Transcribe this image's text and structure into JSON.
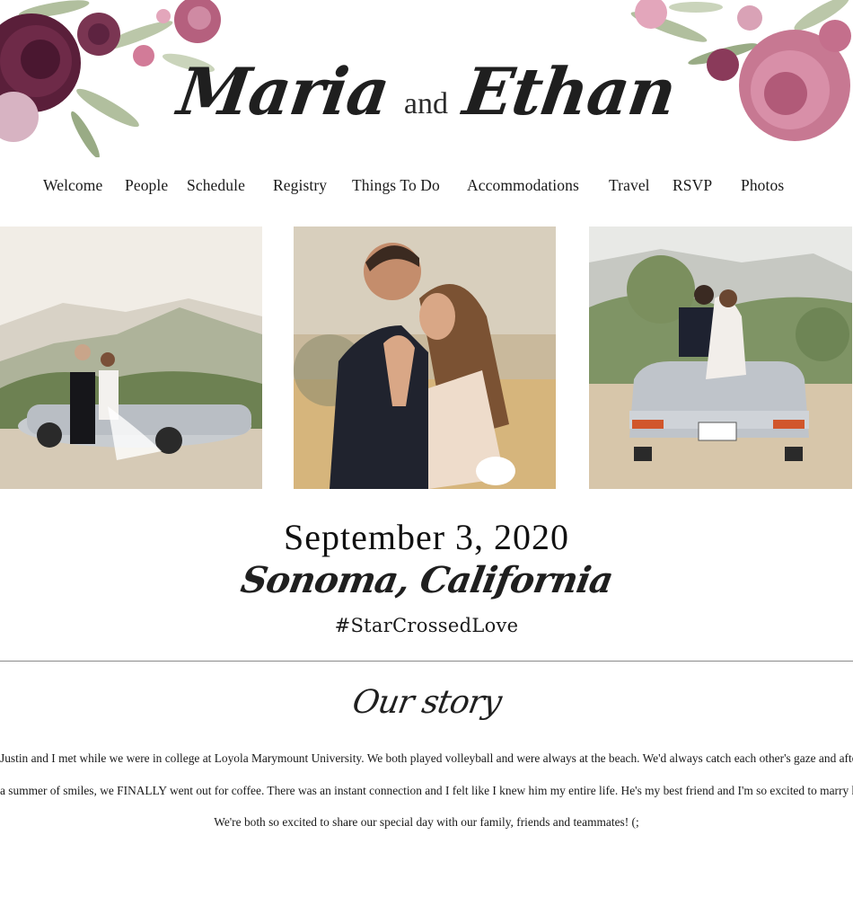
{
  "header": {
    "name_1": "Maria",
    "conjunction": "and",
    "name_2": "Ethan"
  },
  "nav": {
    "items": [
      {
        "label": "Welcome"
      },
      {
        "label": "People"
      },
      {
        "label": "Schedule"
      },
      {
        "label": "Registry"
      },
      {
        "label": "Things To Do"
      },
      {
        "label": "Accommodations"
      },
      {
        "label": "Travel"
      },
      {
        "label": "RSVP"
      },
      {
        "label": "Photos"
      }
    ]
  },
  "event": {
    "date": "September 3, 2020",
    "location": "Sonoma, California",
    "hashtag": "#StarCrossedLove"
  },
  "story": {
    "heading": "Our story",
    "lines": [
      "Justin and I met while we were in college at Loyola Marymount University. We both played volleyball and  were always at the beach. We'd always catch each other's gaze and after",
      "a summer of smiles,  we FINALLY went out for coffee. There was an instant connection and I felt like I knew him my entire life. He's my best friend and I'm so excited to marry him!",
      "We're both so excited to share our special day with  our family, friends and teammates! (;"
    ]
  },
  "colors": {
    "floral_dark": "#5a1f3a",
    "floral_mid": "#b5607e",
    "floral_light": "#e3a6bb",
    "leaf": "#9cae86",
    "text": "#1c1c1c",
    "divider": "#8a8a8a"
  }
}
